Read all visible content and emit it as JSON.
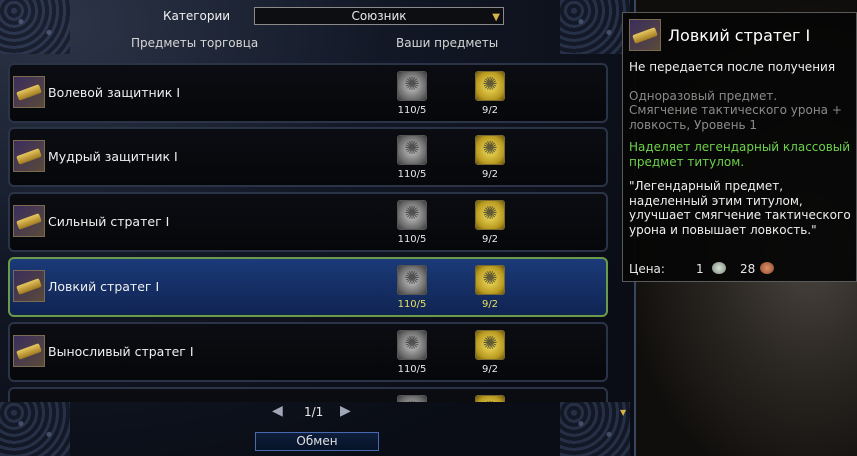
{
  "header": {
    "category_label": "Категории",
    "category_value": "Союзник",
    "col_vendor": "Предметы торговца",
    "col_yours": "Ваши предметы"
  },
  "items": [
    {
      "name": "Волевой защитник I",
      "cost1": "110/5",
      "cost2": "9/2",
      "selected": false
    },
    {
      "name": "Мудрый защитник I",
      "cost1": "110/5",
      "cost2": "9/2",
      "selected": false
    },
    {
      "name": "Сильный стратег I",
      "cost1": "110/5",
      "cost2": "9/2",
      "selected": false
    },
    {
      "name": "Ловкий стратег I",
      "cost1": "110/5",
      "cost2": "9/2",
      "selected": true
    },
    {
      "name": "Выносливый стратег I",
      "cost1": "110/5",
      "cost2": "9/2",
      "selected": false
    }
  ],
  "pager": {
    "text": "1/1"
  },
  "exchange_button": "Обмен",
  "tooltip": {
    "title": "Ловкий стратег I",
    "line1": "Не передается после получения",
    "line2": "Одноразовый предмет.",
    "line3": "Смягчение тактического урона + ловкость, Уровень 1",
    "line4": "Наделяет легендарный классовый предмет титулом.",
    "line5": "\"Легендарный предмет, наделенный этим титулом, улучшает смягчение тактического урона и повышает ловкость.\"",
    "price_label": "Цена:",
    "price_silver": "1",
    "price_copper": "28"
  },
  "icons": {
    "dropdown": "chevron-down-icon",
    "prev": "triangle-left-icon",
    "next": "triangle-right-icon",
    "scroll_down": "scroll-down-icon"
  },
  "colors": {
    "selected_row": "#1a3a78",
    "selected_border": "#6a9a4a",
    "tooltip_green": "#6ed24a",
    "tooltip_gray": "#8a8a8a"
  }
}
